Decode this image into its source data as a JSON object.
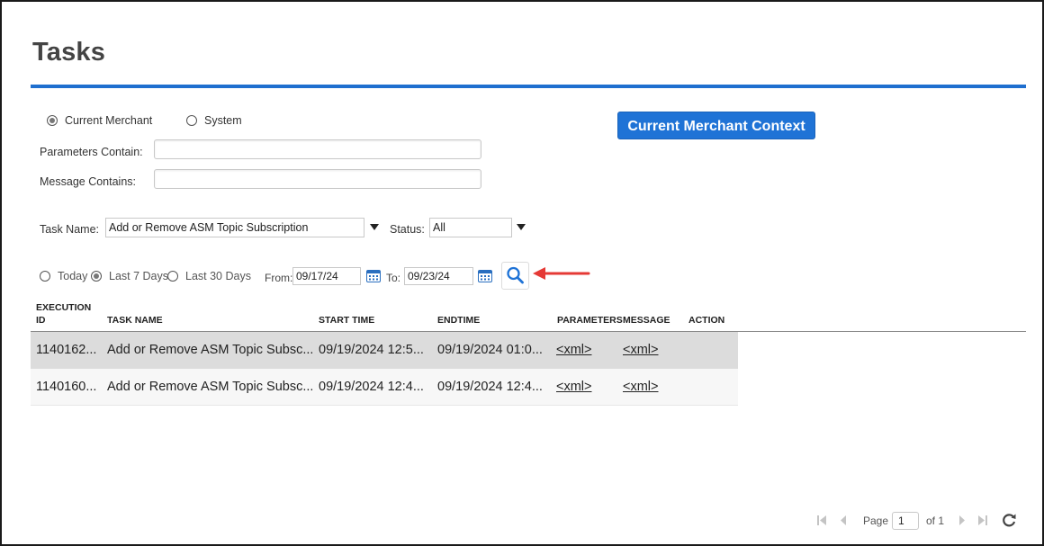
{
  "page": {
    "title": "Tasks"
  },
  "scope": {
    "options": [
      {
        "label": "Current Merchant",
        "selected": true
      },
      {
        "label": "System",
        "selected": false
      }
    ]
  },
  "context_button": {
    "label": "Current Merchant Context"
  },
  "filters": {
    "parameters_label": "Parameters Contain:",
    "parameters_value": "",
    "message_label": "Message Contains:",
    "message_value": "",
    "task_name_label": "Task Name:",
    "task_name_value": "Add or Remove ASM Topic Subscription",
    "status_label": "Status:",
    "status_value": "All"
  },
  "date_range": {
    "options": [
      {
        "label": "Today",
        "selected": false
      },
      {
        "label": "Last 7 Days",
        "selected": true
      },
      {
        "label": "Last 30 Days",
        "selected": false
      }
    ],
    "from_label": "From:",
    "from_value": "09/17/24",
    "to_label": "To:",
    "to_value": "09/23/24"
  },
  "table": {
    "columns": {
      "execution_id_line1": "EXECUTION",
      "execution_id_line2": "ID",
      "task_name": "TASK NAME",
      "start_time": "START TIME",
      "endtime": "ENDTIME",
      "parameters": "PARAMETERS",
      "message": "MESSAGE",
      "action": "ACTION"
    },
    "rows": [
      {
        "execution_id": "1140162...",
        "task_name": "Add or Remove ASM Topic Subsc...",
        "start_time": "09/19/2024 12:5...",
        "endtime": "09/19/2024 01:0...",
        "parameters": "<xml>",
        "message": "<xml>"
      },
      {
        "execution_id": "1140160...",
        "task_name": "Add or Remove ASM Topic Subsc...",
        "start_time": "09/19/2024 12:4...",
        "endtime": "09/19/2024 12:4...",
        "parameters": "<xml>",
        "message": "<xml>"
      }
    ]
  },
  "pager": {
    "page_label": "Page",
    "page_value": "1",
    "of_label": "of 1"
  },
  "colors": {
    "accent": "#1f73d6",
    "annotation_arrow": "#e53935"
  },
  "icons": [
    "calendar-icon",
    "search-icon",
    "first-page-icon",
    "prev-page-icon",
    "next-page-icon",
    "last-page-icon",
    "refresh-icon",
    "dropdown-caret-icon"
  ]
}
